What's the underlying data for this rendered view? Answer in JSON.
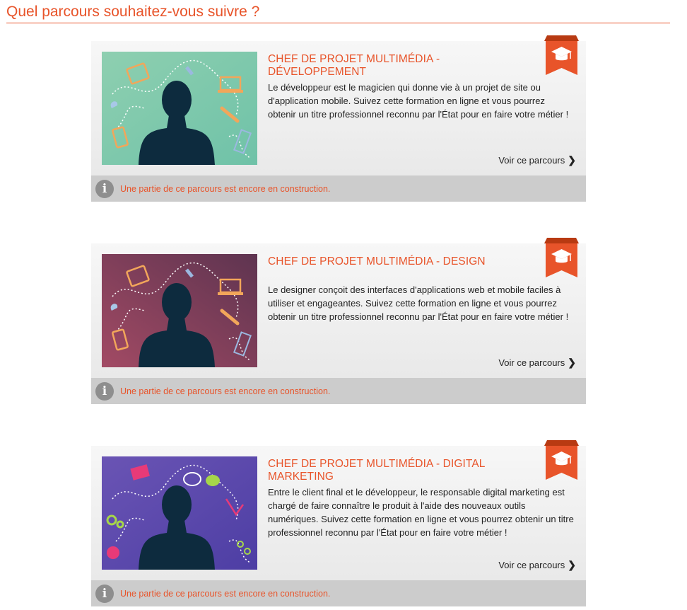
{
  "page": {
    "title": "Quel parcours souhaitez-vous suivre ?"
  },
  "colors": {
    "accent": "#e8542a",
    "notice_bg": "#cccccc",
    "silhouette": "#0d2b3e"
  },
  "cards": [
    {
      "title": "CHEF DE PROJET MULTIMÉDIA - DÉVELOPPEMENT",
      "description": "Le développeur est le magicien qui donne vie à un projet de site ou d'application mobile. Suivez cette formation en ligne et vous pourrez obtenir un titre professionnel reconnu par l'État pour en faire votre métier !",
      "link": "Voir ce parcours",
      "notice": "Une partie de ce parcours est encore en construction.",
      "badge_icon": "graduation-cap-icon",
      "image": "developer-silhouette-illustration",
      "image_colors": [
        "#8ecfb0",
        "#6fc2a8"
      ]
    },
    {
      "title": "CHEF DE PROJET MULTIMÉDIA - DESIGN",
      "description": "Le designer conçoit des interfaces d'applications web et mobile faciles à utiliser et engageantes. Suivez cette formation en ligne et vous pourrez obtenir un titre professionnel reconnu par l'État pour en faire votre métier !",
      "link": "Voir ce parcours",
      "notice": "Une partie de ce parcours est encore en construction.",
      "badge_icon": "graduation-cap-icon",
      "image": "designer-silhouette-illustration",
      "image_colors": [
        "#a24a64",
        "#5e3450"
      ]
    },
    {
      "title": "CHEF DE PROJET MULTIMÉDIA - DIGITAL MARKETING",
      "description": "Entre le client final et le développeur, le responsable digital marketing est chargé de faire connaître le produit à l'aide des nouveaux outils numériques. Suivez cette formation en ligne et vous pourrez obtenir un titre professionnel reconnu par l'État pour en faire votre métier !",
      "link": "Voir ce parcours",
      "notice": "Une partie de ce parcours est encore en construction.",
      "badge_icon": "graduation-cap-icon",
      "image": "marketing-silhouette-illustration",
      "image_colors": [
        "#6a54b4",
        "#4d3ea4"
      ]
    }
  ]
}
